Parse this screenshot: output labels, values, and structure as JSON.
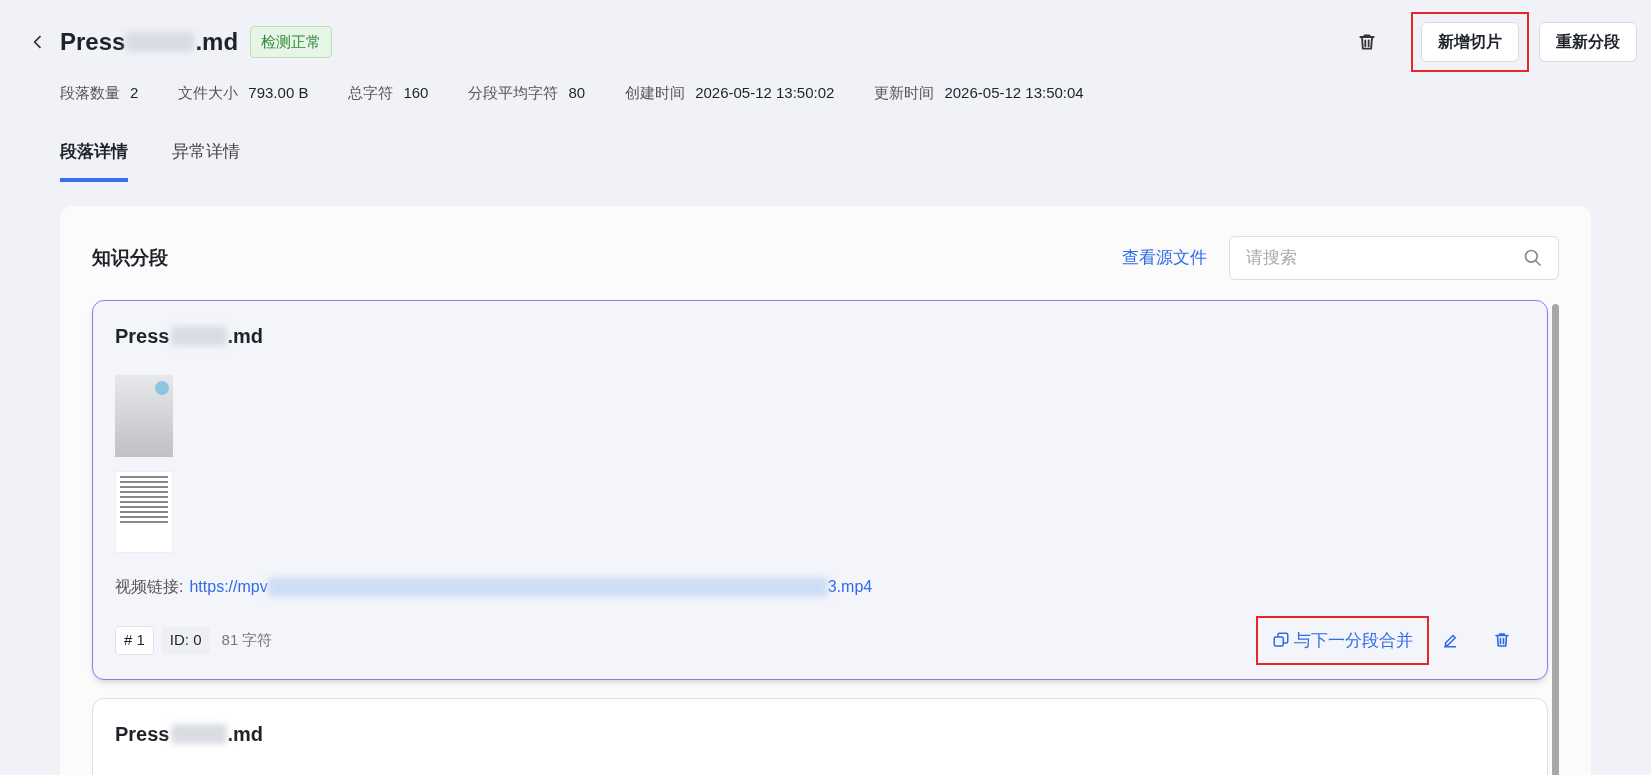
{
  "header": {
    "title_start": "Press",
    "title_end": ".md",
    "status_badge": "检测正常",
    "actions": [
      {
        "kind": "icon"
      },
      {
        "kind": "button",
        "label": "新增切片",
        "highlighted": true
      },
      {
        "kind": "button",
        "label": "重新分段",
        "highlighted": false
      }
    ]
  },
  "stats": [
    {
      "label": "段落数量",
      "value": "2"
    },
    {
      "label": "文件大小",
      "value": "793.00 B"
    },
    {
      "label": "总字符",
      "value": "160"
    },
    {
      "label": "分段平均字符",
      "value": "80"
    },
    {
      "label": "创建时间",
      "value": "2026-05-12 13:50:02"
    },
    {
      "label": "更新时间",
      "value": "2026-05-12 13:50:04"
    }
  ],
  "tabs": [
    {
      "label": "段落详情",
      "selected": true
    },
    {
      "label": "异常详情",
      "selected": false
    }
  ],
  "panel": {
    "title": "知识分段",
    "source_link": "查看源文件",
    "search": {
      "placeholder": "请搜索"
    },
    "segments": [
      {
        "title_start": "Press",
        "title_end": ".md",
        "selected": true,
        "images": [
          {
            "kind": "cover"
          },
          {
            "kind": "contents"
          }
        ],
        "link_label": "视频链接:",
        "link_start": "https://mpv",
        "link_end": "3.mp4",
        "index": "# 1",
        "id": "ID: 0",
        "chars": "81 字符",
        "merge_label": "与下一分段合并",
        "merge_highlighted": true
      },
      {
        "title_start": "Press",
        "title_end": ".md",
        "selected": false
      }
    ]
  }
}
